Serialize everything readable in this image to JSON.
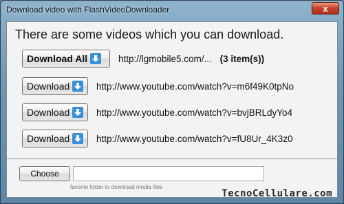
{
  "window": {
    "title": "Download video with FlashVideoDownloader",
    "close_glyph": "x"
  },
  "main": {
    "heading": "There are some videos which you can download.",
    "download_all": {
      "label": "Download All",
      "url": "http://lgmobile5.com/...",
      "count": "(3 item(s))"
    },
    "videos": [
      {
        "label": "Download",
        "url": "http://www.youtube.com/watch?v=m6f49K0tpNo"
      },
      {
        "label": "Download",
        "url": "http://www.youtube.com/watch?v=bvjBRLdyYo4"
      },
      {
        "label": "Download",
        "url": "http://www.youtube.com/watch?v=fU8Ur_4K3z0"
      }
    ],
    "download_icon": "download-arrow-icon"
  },
  "footer": {
    "choose_label": "Choose",
    "folder_value": "",
    "hint": "favorite folder to download media files"
  },
  "watermark": "TecnoCellulare.com",
  "colors": {
    "accent_blue": "#3a8fd8",
    "close_red": "#c8452c",
    "title_bar": "#6f97b4"
  }
}
